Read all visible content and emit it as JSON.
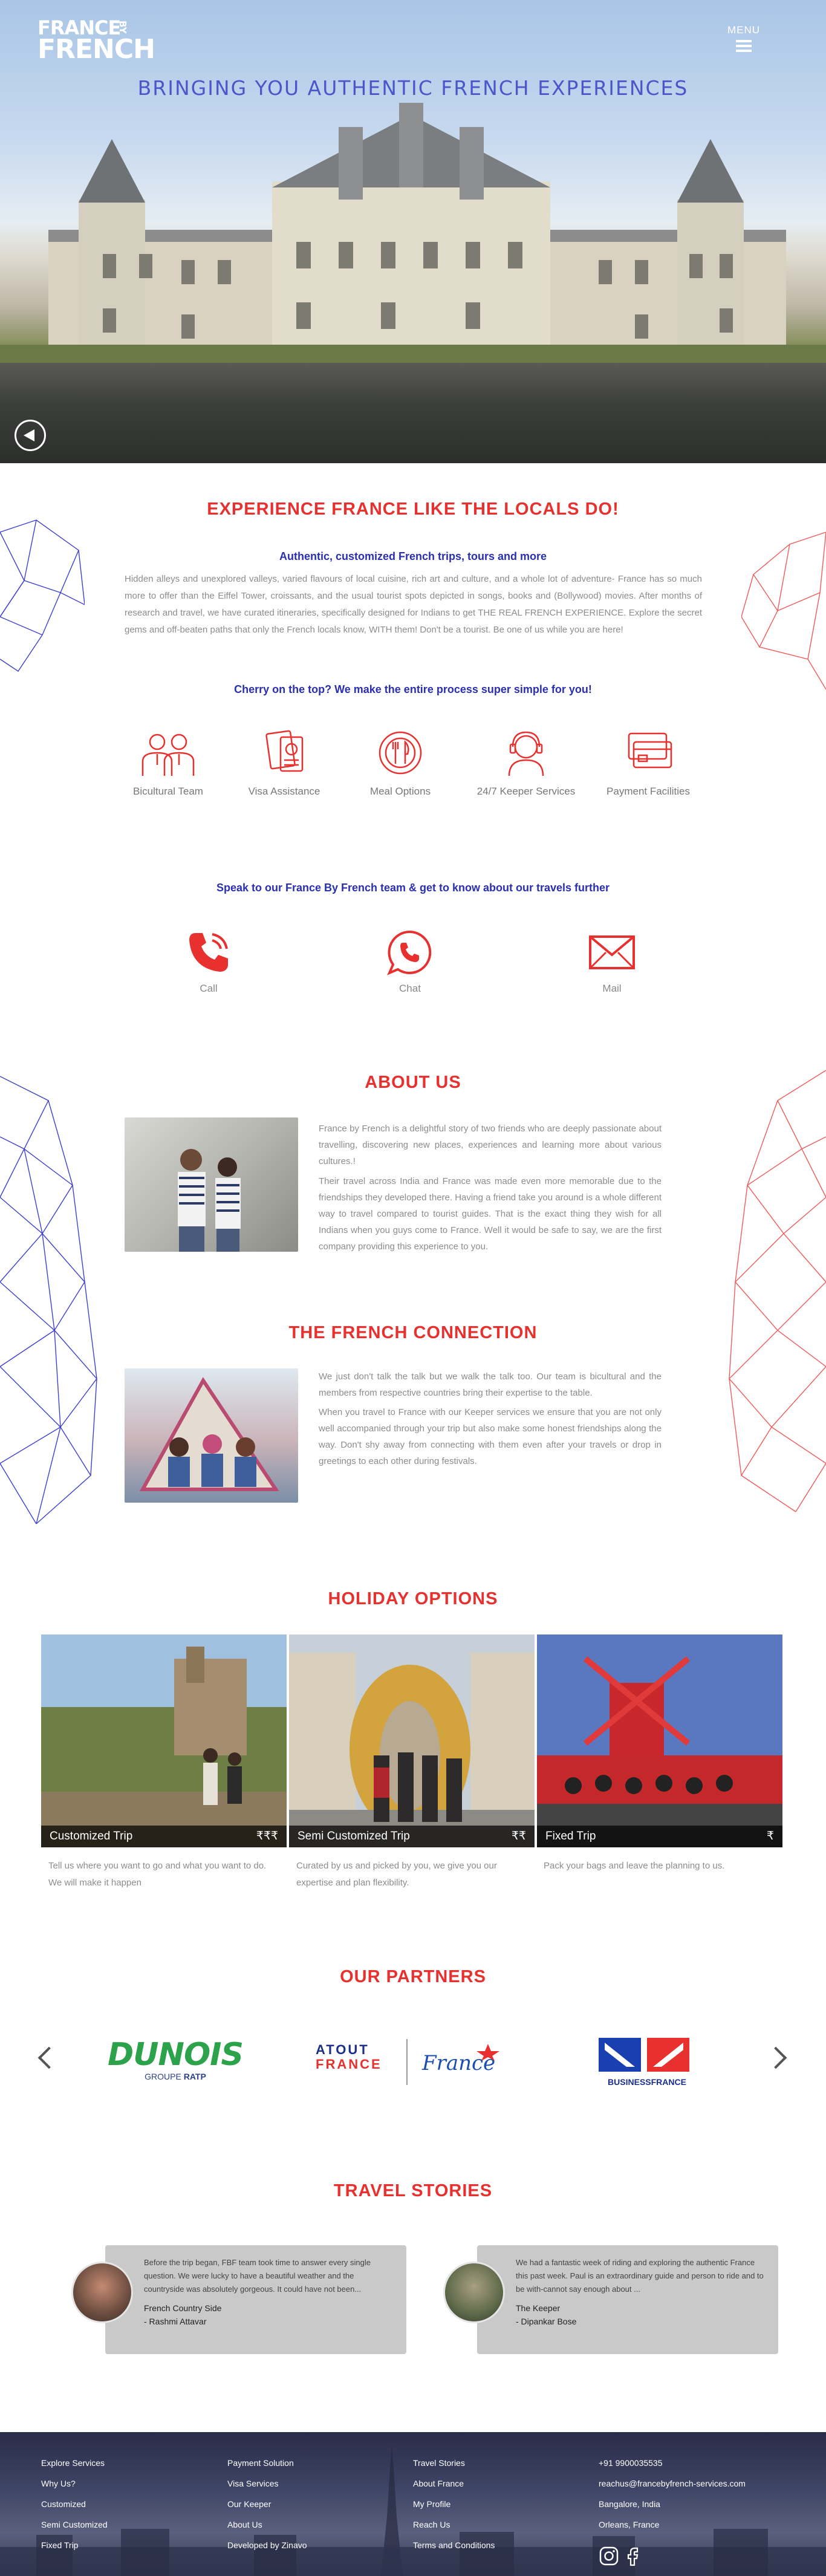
{
  "hero": {
    "logo_line1": "FRANCE",
    "logo_by": "BY",
    "logo_line2": "FRENCH",
    "menu_label": "MENU",
    "tagline": "BRINGING YOU AUTHENTIC FRENCH EXPERIENCES"
  },
  "experience": {
    "heading": "EXPERIENCE FRANCE LIKE THE LOCALS DO!",
    "subheading": "Authentic, customized French trips, tours and more",
    "body": "Hidden alleys and unexplored valleys, varied flavours of local cuisine, rich art and culture, and a whole lot of adventure- France has so much more to offer than the Eiffel Tower, croissants, and the usual tourist spots depicted in songs, books and (Bollywood) movies. After months of research and travel, we have curated itineraries, specifically designed for Indians to get THE REAL FRENCH EXPERIENCE. Explore the secret gems and off-beaten paths that only the French locals know, WITH them! Don't be a tourist. Be one of us while you are here!",
    "cherry": "Cherry on the top? We make the entire process super simple for you!",
    "features": [
      {
        "icon": "team-icon",
        "label": "Bicultural Team"
      },
      {
        "icon": "passport-icon",
        "label": "Visa Assistance"
      },
      {
        "icon": "meal-icon",
        "label": "Meal Options"
      },
      {
        "icon": "keeper-icon",
        "label": "24/7 Keeper Services"
      },
      {
        "icon": "payment-icon",
        "label": "Payment Facilities"
      }
    ]
  },
  "contact": {
    "heading": "Speak to our France By French team & get to know about our travels further",
    "items": [
      {
        "icon": "phone-icon",
        "label": "Call"
      },
      {
        "icon": "chat-icon",
        "label": "Chat"
      },
      {
        "icon": "mail-icon",
        "label": "Mail"
      }
    ]
  },
  "about": {
    "heading": "ABOUT US",
    "p1": "France by French is a delightful story of two friends who are deeply passionate about travelling, discovering new places, experiences and learning more about various cultures.!",
    "p2": "Their travel across India and France was made even more memorable due to the friendships they developed there. Having a friend take you around is a whole different way to travel compared to tourist guides. That is the exact thing they wish for all Indians when you guys come to France. Well it would be safe to say, we are the first company providing this experience to you."
  },
  "connection": {
    "heading": "THE FRENCH CONNECTION",
    "p1": "We just don't talk the talk but we walk the talk too. Our team is bicultural and the members from respective countries bring their expertise to the table.",
    "p2": "When you travel to France with our Keeper services we ensure that you are not only well accompanied through your trip but also make some honest friendships along the way. Don't shy away from connecting with them even after your travels or drop in greetings to each other during festivals."
  },
  "holiday": {
    "heading": "HOLIDAY OPTIONS",
    "cards": [
      {
        "title": "Customized Trip",
        "price": "₹₹₹",
        "desc": "Tell us where you want to go and what you want to do. We will make it happen"
      },
      {
        "title": "Semi Customized Trip",
        "price": "₹₹",
        "desc": "Curated by us and picked by you, we give you our expertise and plan flexibility."
      },
      {
        "title": "Fixed Trip",
        "price": "₹",
        "desc": "Pack your bags and leave the planning to us."
      }
    ]
  },
  "partners": {
    "heading": "OUR PARTNERS",
    "dunois": "DUNOIS",
    "dunois_sub": "GROUPE",
    "ratp": "RATP",
    "atout_1": "ATOUT",
    "atout_2": "FRANCE",
    "france_script": "France",
    "business": "BUSINESSFRANCE"
  },
  "stories": {
    "heading": "TRAVEL STORIES",
    "items": [
      {
        "text": "Before the trip began, FBF team took time to answer every single question. We were lucky to have a beautiful weather and the countryside was absolutely gorgeous. It could have not been...",
        "trip": "French Country Side",
        "author": "- Rashmi Attavar"
      },
      {
        "text": "We had a fantastic week of riding and exploring the authentic France this past week. Paul is an extraordinary guide and person to ride and to be with-cannot say enough about ...",
        "trip": "The Keeper",
        "author": "- Dipankar Bose"
      }
    ]
  },
  "footer": {
    "col1": [
      "Explore Services",
      "Why Us?",
      "Customized",
      "Semi Customized",
      "Fixed Trip"
    ],
    "col2": [
      "Payment Solution",
      "Visa Services",
      "Our Keeper",
      "About Us",
      "Developed by Zinavo"
    ],
    "col3": [
      "Travel Stories",
      "About France",
      "My Profile",
      "Reach Us",
      "Terms and Conditions"
    ],
    "col4": [
      "+91 9900035535",
      "reachus@francebyfrench-services.com",
      "Bangalore, India",
      "Orleans, France"
    ]
  },
  "colors": {
    "accent_red": "#e8312f",
    "accent_blue": "#2a2fb2"
  }
}
